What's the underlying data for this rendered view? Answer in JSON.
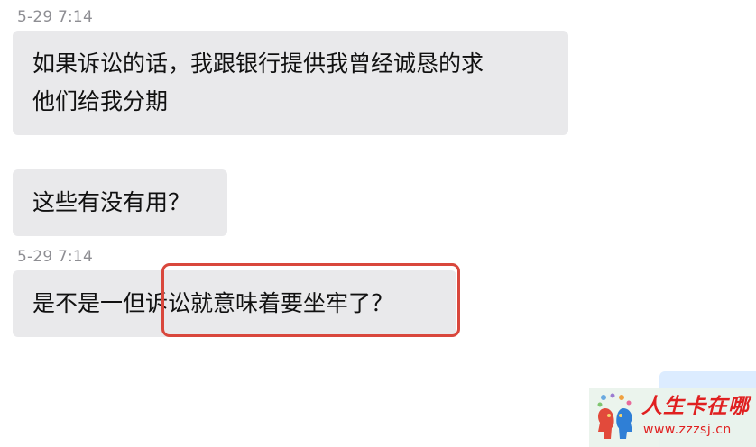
{
  "messages": [
    {
      "timestamp": "5-29 7:14",
      "lines": [
        "如果诉讼的话，我跟银行提供我曾经诚恳的求",
        "他们给我分期"
      ]
    },
    {
      "lines": [
        "这些有没有用？"
      ]
    },
    {
      "timestamp": "5-29 7:14",
      "lines": [
        "是不是一但诉讼就意味着要坐牢了？"
      ]
    }
  ],
  "annotation": {
    "highlighted_text": "诉讼就意味着要坐牢了？",
    "color": "#d9473c"
  },
  "colors": {
    "incoming_bubble": "#e9e9eb",
    "outgoing_bubble": "#dcecff",
    "timestamp": "#8e8e93",
    "watermark_red": "#e02020"
  },
  "watermark": {
    "title": "人生卡在哪",
    "url": "www.zzzsj.cn",
    "icon": "two-heads-logo-icon"
  }
}
